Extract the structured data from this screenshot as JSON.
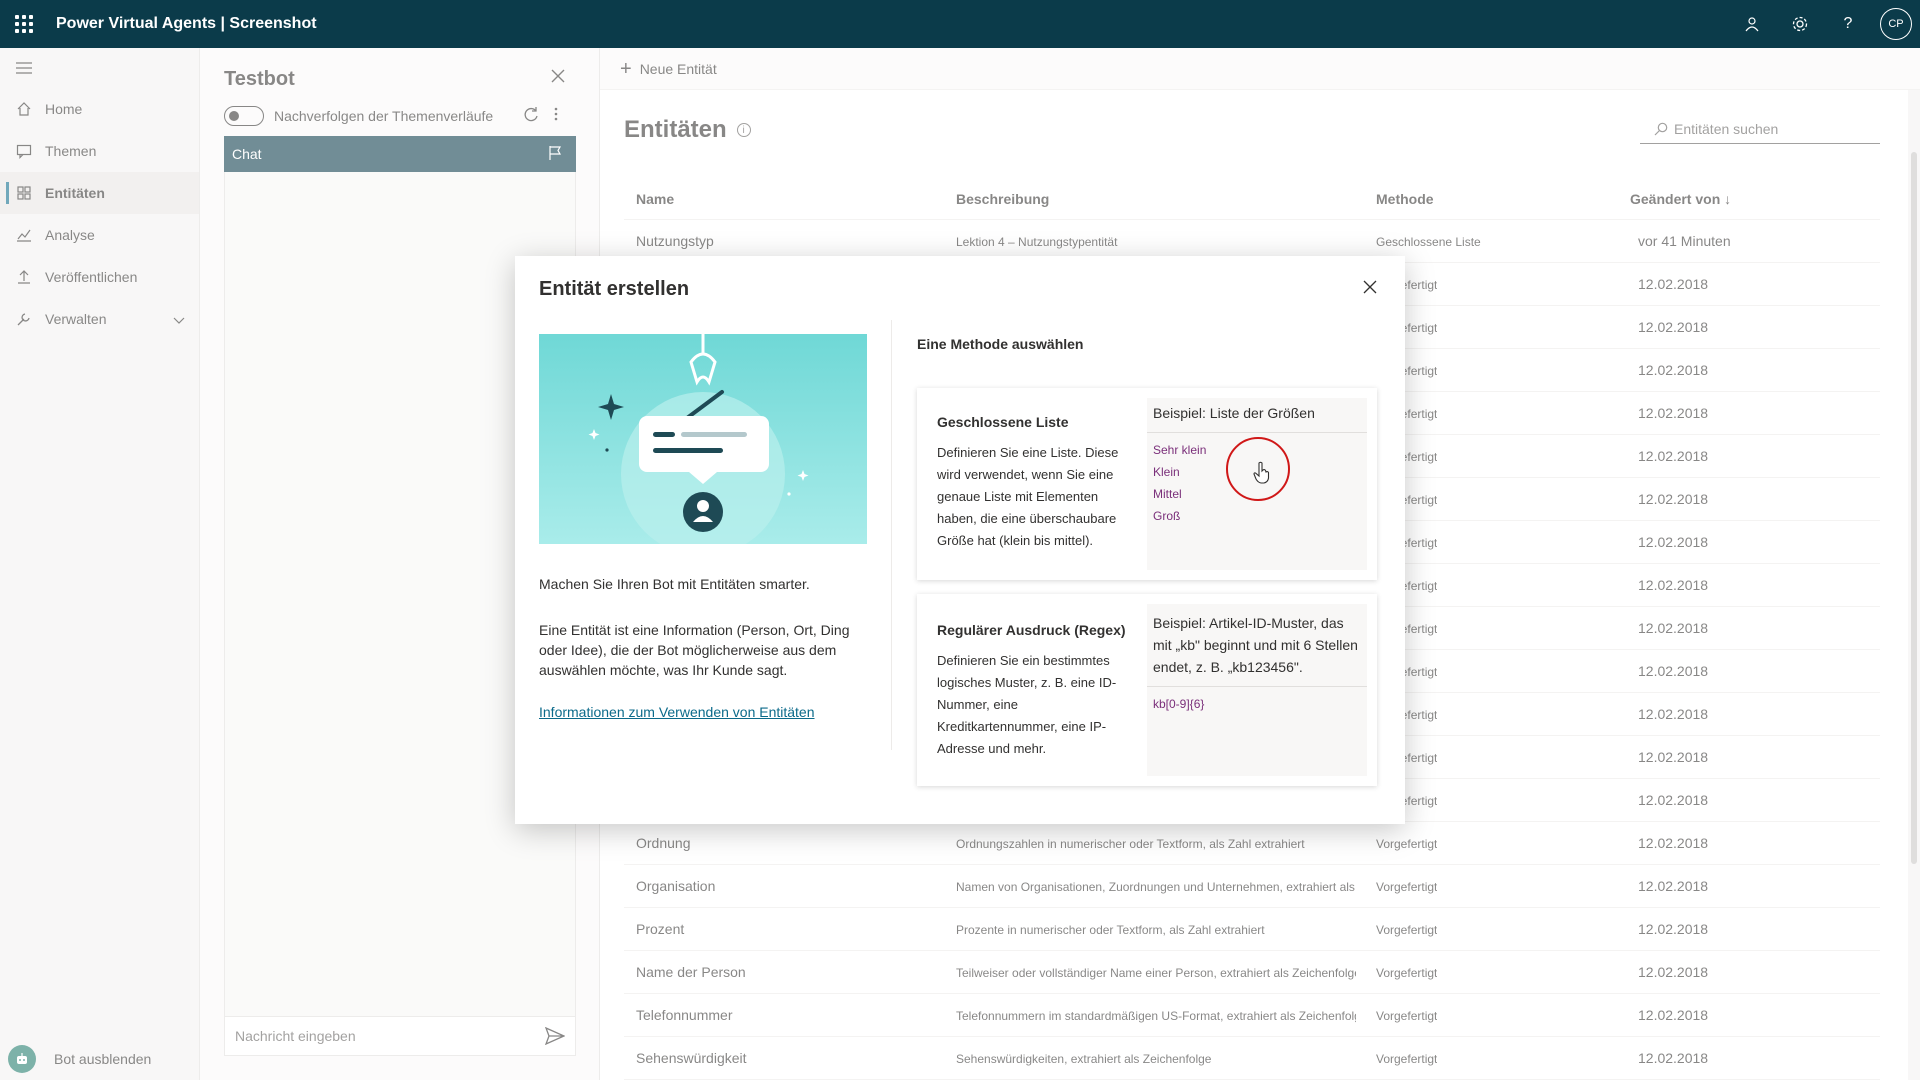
{
  "app": {
    "title": "Power Virtual Agents | Screenshot",
    "avatar_initials": "CP"
  },
  "nav": {
    "items": [
      {
        "label": "Home",
        "icon": "home-icon"
      },
      {
        "label": "Themen",
        "icon": "chat-icon"
      },
      {
        "label": "Entitäten",
        "icon": "entities-icon",
        "active": true
      },
      {
        "label": "Analyse",
        "icon": "chart-icon"
      },
      {
        "label": "Veröffentlichen",
        "icon": "upload-icon"
      },
      {
        "label": "Verwalten",
        "icon": "wrench-icon"
      }
    ],
    "bot_hide_label": "Bot ausblenden"
  },
  "testbot": {
    "title": "Testbot",
    "track_label": "Nachverfolgen der Themenverläufe",
    "chat_label": "Chat",
    "input_placeholder": "Nachricht eingeben"
  },
  "main": {
    "new_entity_label": "Neue Entität",
    "page_title": "Entitäten",
    "search_placeholder": "Entitäten suchen",
    "columns": {
      "name": "Name",
      "description": "Beschreibung",
      "method": "Methode",
      "changed_by": "Geändert von ↓"
    },
    "rows": [
      {
        "name": "Nutzungstyp",
        "description": "Lektion 4 – Nutzungstypentität",
        "method": "Geschlossene Liste",
        "date": "vor 41 Minuten"
      },
      {
        "name": "",
        "description": "",
        "method": "Vorgefertigt",
        "date": "12.02.2018"
      },
      {
        "name": "",
        "description": "",
        "method": "Vorgefertigt",
        "date": "12.02.2018"
      },
      {
        "name": "",
        "description": "",
        "method": "Vorgefertigt",
        "date": "12.02.2018"
      },
      {
        "name": "",
        "description": "",
        "method": "Vorgefertigt",
        "date": "12.02.2018"
      },
      {
        "name": "",
        "description": "",
        "method": "Vorgefertigt",
        "date": "12.02.2018"
      },
      {
        "name": "",
        "description": "",
        "method": "Vorgefertigt",
        "date": "12.02.2018"
      },
      {
        "name": "",
        "description": "",
        "method": "Vorgefertigt",
        "date": "12.02.2018"
      },
      {
        "name": "",
        "description": "",
        "method": "Vorgefertigt",
        "date": "12.02.2018"
      },
      {
        "name": "",
        "description": "",
        "method": "Vorgefertigt",
        "date": "12.02.2018"
      },
      {
        "name": "",
        "description": "",
        "method": "Vorgefertigt",
        "date": "12.02.2018"
      },
      {
        "name": "",
        "description": "",
        "method": "Vorgefertigt",
        "date": "12.02.2018"
      },
      {
        "name": "",
        "description": "",
        "method": "Vorgefertigt",
        "date": "12.02.2018"
      },
      {
        "name": "",
        "description": "",
        "method": "Vorgefertigt",
        "date": "12.02.2018"
      },
      {
        "name": "Ordnung",
        "description": "Ordnungszahlen in numerischer oder Textform, als Zahl extrahiert",
        "method": "Vorgefertigt",
        "date": "12.02.2018"
      },
      {
        "name": "Organisation",
        "description": "Namen von Organisationen, Zuordnungen und Unternehmen, extrahiert als",
        "method": "Vorgefertigt",
        "date": "12.02.2018"
      },
      {
        "name": "Prozent",
        "description": "Prozente in numerischer oder Textform, als Zahl extrahiert",
        "method": "Vorgefertigt",
        "date": "12.02.2018"
      },
      {
        "name": "Name der Person",
        "description": "Teilweiser oder vollständiger Name einer Person, extrahiert als Zeichenfolge",
        "method": "Vorgefertigt",
        "date": "12.02.2018"
      },
      {
        "name": "Telefonnummer",
        "description": "Telefonnummern im standardmäßigen US-Format, extrahiert als Zeichenfolg",
        "method": "Vorgefertigt",
        "date": "12.02.2018"
      },
      {
        "name": "Sehenswürdigkeit",
        "description": "Sehenswürdigkeiten, extrahiert als Zeichenfolge",
        "method": "Vorgefertigt",
        "date": "12.02.2018"
      }
    ]
  },
  "modal": {
    "title": "Entität erstellen",
    "intro": "Machen Sie Ihren Bot mit Entitäten smarter.",
    "body": "Eine Entität ist eine Information (Person, Ort, Ding oder Idee), die der Bot möglicherweise aus dem auswählen möchte, was Ihr Kunde sagt.",
    "link": "Informationen zum Verwenden von Entitäten",
    "method_label": "Eine Methode auswählen",
    "cards": [
      {
        "title": "Geschlossene Liste",
        "description": "Definieren Sie eine Liste. Diese wird verwendet, wenn Sie eine genaue Liste mit Elementen haben, die eine überschaubare Größe hat (klein bis mittel).",
        "example_head": "Beispiel: Liste der Größen",
        "example_items": [
          "Sehr klein",
          "Klein",
          "Mittel",
          "Groß"
        ]
      },
      {
        "title": "Regulärer Ausdruck (Regex)",
        "description": "Definieren Sie ein bestimmtes logisches Muster, z. B. eine ID-Nummer, eine Kreditkartennummer, eine IP-Adresse und mehr.",
        "example_head": "Beispiel: Artikel-ID-Muster, das mit „kb\" beginnt und mit 6 Stellen endet, z. B. „kb123456\".",
        "example_items": [
          "kb[0-9]{6}"
        ]
      }
    ]
  },
  "colors": {
    "topbar": "#0b3b4a",
    "accent": "#0b6a8a",
    "example_text": "#7a2f7a",
    "cursor_ring": "#d01818"
  }
}
